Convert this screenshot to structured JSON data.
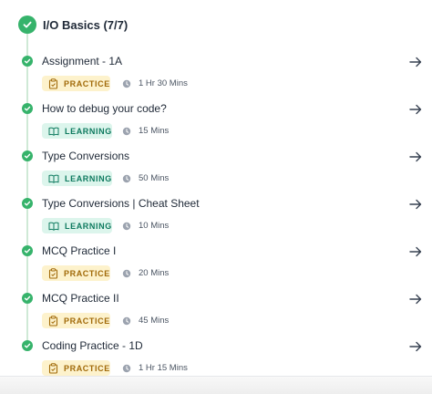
{
  "section": {
    "title": "I/O Basics (7/7)"
  },
  "colors": {
    "success": "#36b36b",
    "practice_bg": "#fdf2cc",
    "learning_bg": "#dcf5ec"
  },
  "items": [
    {
      "title": "Assignment - 1A",
      "type": "PRACTICE",
      "duration": "1 Hr 30 Mins",
      "icon": "clipboard-icon"
    },
    {
      "title": "How to debug your code?",
      "type": "LEARNING",
      "duration": "15 Mins",
      "icon": "book-icon"
    },
    {
      "title": "Type Conversions",
      "type": "LEARNING",
      "duration": "50 Mins",
      "icon": "book-icon"
    },
    {
      "title": "Type Conversions | Cheat Sheet",
      "type": "LEARNING",
      "duration": "10 Mins",
      "icon": "book-icon"
    },
    {
      "title": "MCQ Practice I",
      "type": "PRACTICE",
      "duration": "20 Mins",
      "icon": "clipboard-icon"
    },
    {
      "title": "MCQ Practice II",
      "type": "PRACTICE",
      "duration": "45 Mins",
      "icon": "clipboard-icon"
    },
    {
      "title": "Coding Practice - 1D",
      "type": "PRACTICE",
      "duration": "1 Hr 15 Mins",
      "icon": "clipboard-icon"
    }
  ]
}
